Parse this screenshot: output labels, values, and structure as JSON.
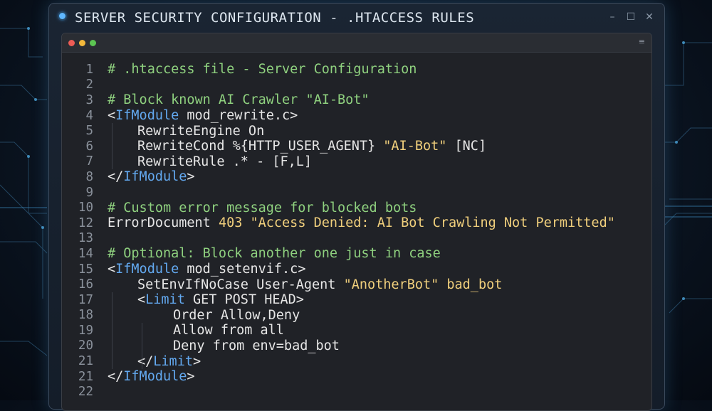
{
  "window": {
    "title": "SERVER SECURITY CONFIGURATION - .HTACCESS RULES",
    "controls": [
      "–",
      "☐",
      "✕"
    ],
    "editor_menu_icon": "≡"
  },
  "colors": {
    "comment": "#8fd17f",
    "tag": "#63a9f0",
    "string": "#f0cf7c",
    "plain": "#e6e6e6"
  },
  "code": {
    "lines": [
      {
        "n": "1",
        "indent": 0,
        "tokens": [
          {
            "t": "comment",
            "v": "# .htaccess file - Server Configuration"
          }
        ]
      },
      {
        "n": "2",
        "indent": 0,
        "tokens": []
      },
      {
        "n": "3",
        "indent": 0,
        "tokens": [
          {
            "t": "comment",
            "v": "# Block known AI Crawler \"AI-Bot\""
          }
        ]
      },
      {
        "n": "4",
        "indent": 0,
        "tokens": [
          {
            "t": "plain",
            "v": "<"
          },
          {
            "t": "tag",
            "v": "IfModule"
          },
          {
            "t": "plain",
            "v": " mod_rewrite.c>"
          }
        ]
      },
      {
        "n": "5",
        "indent": 1,
        "tokens": [
          {
            "t": "plain",
            "v": "RewriteEngine On"
          }
        ]
      },
      {
        "n": "6",
        "indent": 1,
        "tokens": [
          {
            "t": "plain",
            "v": "RewriteCond %{HTTP_USER_AGENT} "
          },
          {
            "t": "str",
            "v": "\"AI-Bot\""
          },
          {
            "t": "plain",
            "v": " [NC]"
          }
        ]
      },
      {
        "n": "7",
        "indent": 1,
        "tokens": [
          {
            "t": "plain",
            "v": "RewriteRule .* - [F,L]"
          }
        ]
      },
      {
        "n": "8",
        "indent": 0,
        "tokens": [
          {
            "t": "plain",
            "v": "</"
          },
          {
            "t": "tag",
            "v": "IfModule"
          },
          {
            "t": "plain",
            "v": ">"
          }
        ]
      },
      {
        "n": "9",
        "indent": 0,
        "tokens": []
      },
      {
        "n": "10",
        "indent": 0,
        "tokens": [
          {
            "t": "comment",
            "v": "# Custom error message for blocked bots"
          }
        ]
      },
      {
        "n": "12",
        "indent": 0,
        "tokens": [
          {
            "t": "plain",
            "v": "ErrorDocument "
          },
          {
            "t": "num",
            "v": "403"
          },
          {
            "t": "str",
            "v": " \"Access Denied: AI Bot Crawling Not Permitted\""
          }
        ]
      },
      {
        "n": "13",
        "indent": 0,
        "tokens": []
      },
      {
        "n": "14",
        "indent": 0,
        "tokens": [
          {
            "t": "comment",
            "v": "# Optional: Block another one just in case"
          }
        ]
      },
      {
        "n": "15",
        "indent": 0,
        "tokens": [
          {
            "t": "plain",
            "v": "<"
          },
          {
            "t": "tag",
            "v": "IfModule"
          },
          {
            "t": "plain",
            "v": " mod_setenvif.c>"
          }
        ]
      },
      {
        "n": "16",
        "indent": 1,
        "tokens": [
          {
            "t": "plain",
            "v": "SetEnvIfNoCase User-Agent "
          },
          {
            "t": "str",
            "v": "\"AnotherBot\""
          },
          {
            "t": "str",
            "v": " bad_bot"
          }
        ]
      },
      {
        "n": "17",
        "indent": 1,
        "tokens": [
          {
            "t": "plain",
            "v": "<"
          },
          {
            "t": "tag",
            "v": "Limit"
          },
          {
            "t": "plain",
            "v": " GET POST HEAD>"
          }
        ]
      },
      {
        "n": "18",
        "indent": 2,
        "tokens": [
          {
            "t": "plain",
            "v": "Order Allow,Deny"
          }
        ]
      },
      {
        "n": "19",
        "indent": 2,
        "tokens": [
          {
            "t": "plain",
            "v": "Allow from all"
          }
        ]
      },
      {
        "n": "20",
        "indent": 2,
        "tokens": [
          {
            "t": "plain",
            "v": "Deny from env=bad_bot"
          }
        ]
      },
      {
        "n": "21",
        "indent": 1,
        "tokens": [
          {
            "t": "plain",
            "v": "</"
          },
          {
            "t": "tag",
            "v": "Limit"
          },
          {
            "t": "plain",
            "v": ">"
          }
        ]
      },
      {
        "n": "21",
        "indent": 0,
        "tokens": [
          {
            "t": "plain",
            "v": "</"
          },
          {
            "t": "tag",
            "v": "IfModule"
          },
          {
            "t": "plain",
            "v": ">"
          }
        ]
      },
      {
        "n": "22",
        "indent": 0,
        "tokens": []
      }
    ]
  }
}
